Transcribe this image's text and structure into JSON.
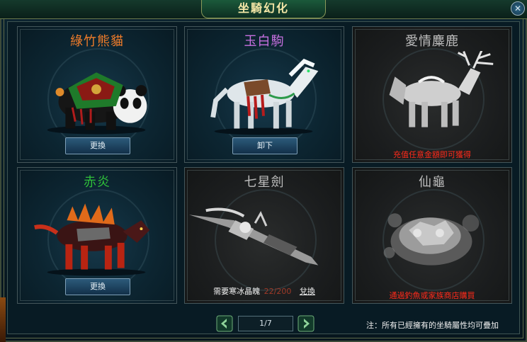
{
  "window": {
    "title": "坐騎幻化",
    "close_icon": "✕"
  },
  "cards": [
    {
      "name": "綠竹熊貓",
      "name_color": "#f07c2a",
      "state": "active",
      "button": "更換"
    },
    {
      "name": "玉白駒",
      "name_color": "#c770e0",
      "state": "active",
      "button": "卸下"
    },
    {
      "name": "愛情麋鹿",
      "name_color": "#bdbdbd",
      "state": "locked",
      "note": "充值任意金額即可獲得"
    },
    {
      "name": "赤炎",
      "name_color": "#2fbf3a",
      "state": "active",
      "button": "更換"
    },
    {
      "name": "七星劍",
      "name_color": "#bdbdbd",
      "state": "locked",
      "req_text": "需要寒冰晶魄",
      "req_count": "22/200",
      "req_link": "兌換"
    },
    {
      "name": "仙龜",
      "name_color": "#bdbdbd",
      "state": "locked",
      "note": "通過釣魚或家族商店購買"
    }
  ],
  "pager": {
    "page": "1/7",
    "prev_icon": "arrow-left-icon",
    "next_icon": "arrow-right-icon"
  },
  "footer": {
    "note": "注：所有已經擁有的坐騎屬性均可疊加"
  },
  "colors": {
    "req_count": "#a03a28",
    "note_red": "#ff2a1a",
    "accent": "#f3e6a6"
  }
}
